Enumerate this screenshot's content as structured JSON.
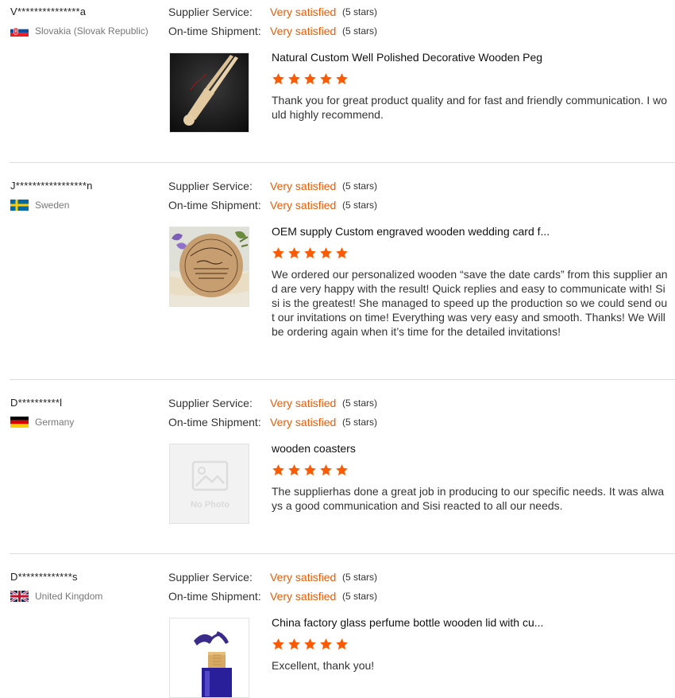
{
  "colors": {
    "accent": "#ee5a00",
    "star": "#ff5a00",
    "separator": "#dddddd"
  },
  "reviews": [
    {
      "name": "V***************a",
      "country": "Slovakia (Slovak Republic)",
      "flag_icon": "slovakia-flag-icon",
      "supplier_service_label": "Supplier Service:",
      "supplier_service_value": "Very satisfied",
      "supplier_service_stars": "(5 stars)",
      "shipment_label": "On-time Shipment:",
      "shipment_value": "Very satisfied",
      "shipment_stars": "(5 stars)",
      "product_title": "Natural Custom Well Polished Decorative Wooden Peg",
      "product_image": "wooden-peg-photo",
      "rating": 5,
      "comment": "Thank you for great product quality and for fast and friendly communication. I would highly recommend."
    },
    {
      "name": "J*****************n",
      "country": "Sweden",
      "flag_icon": "sweden-flag-icon",
      "supplier_service_label": "Supplier Service:",
      "supplier_service_value": "Very satisfied",
      "supplier_service_stars": "(5 stars)",
      "shipment_label": "On-time Shipment:",
      "shipment_value": "Very satisfied",
      "shipment_stars": "(5 stars)",
      "product_title": "OEM supply Custom engraved wooden wedding card f...",
      "product_image": "engraved-wooden-card-photo",
      "rating": 5,
      "comment": "We ordered our personalized wooden “save the date cards” from this supplier and are very happy with the result! Quick replies and easy to communicate with! Sisi is the greatest! She managed to speed up the production so we could send out our invitations on time! Everything was very easy and smooth. Thanks! We Will be ordering again when it’s time for the detailed invitations!"
    },
    {
      "name": "D**********l",
      "country": "Germany",
      "flag_icon": "germany-flag-icon",
      "supplier_service_label": "Supplier Service:",
      "supplier_service_value": "Very satisfied",
      "supplier_service_stars": "(5 stars)",
      "shipment_label": "On-time Shipment:",
      "shipment_value": "Very satisfied",
      "shipment_stars": "(5 stars)",
      "product_title": "wooden coasters",
      "product_image": "no-photo-placeholder",
      "no_photo_text": "No Photo",
      "rating": 5,
      "comment": "The supplierhas done a great job in producing to our specific needs. It was always a good communication and Sisi reacted to all our needs."
    },
    {
      "name": "D*************s",
      "country": "United Kingdom",
      "flag_icon": "uk-flag-icon",
      "supplier_service_label": "Supplier Service:",
      "supplier_service_value": "Very satisfied",
      "supplier_service_stars": "(5 stars)",
      "shipment_label": "On-time Shipment:",
      "shipment_value": "Very satisfied",
      "shipment_stars": "(5 stars)",
      "product_title": "China factory glass perfume bottle wooden lid with cu...",
      "product_image": "perfume-bottle-photo",
      "rating": 5,
      "comment": "Excellent, thank you!"
    }
  ]
}
